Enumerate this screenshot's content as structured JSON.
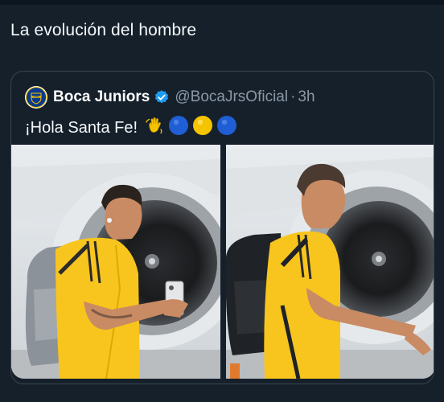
{
  "post": {
    "text": "La evolución del hombre"
  },
  "quote": {
    "name": "Boca Juniors",
    "handle": "@BocaJrsOficial",
    "separator": "·",
    "time": "3h",
    "text": "¡Hola Santa Fe!",
    "emojis": [
      "waving-hand",
      "blue-circle",
      "yellow-circle",
      "blue-circle"
    ],
    "avatar_text": "CABJ"
  },
  "media": [
    {
      "description_icon": "player-photo-left"
    },
    {
      "description_icon": "player-photo-right"
    }
  ],
  "colors": {
    "background": "#15202b",
    "border": "#38444d",
    "muted_text": "#8b98a5",
    "verified": "#1d9bf0",
    "boca_blue": "#0a3a8c",
    "boca_yellow": "#f5c400"
  }
}
